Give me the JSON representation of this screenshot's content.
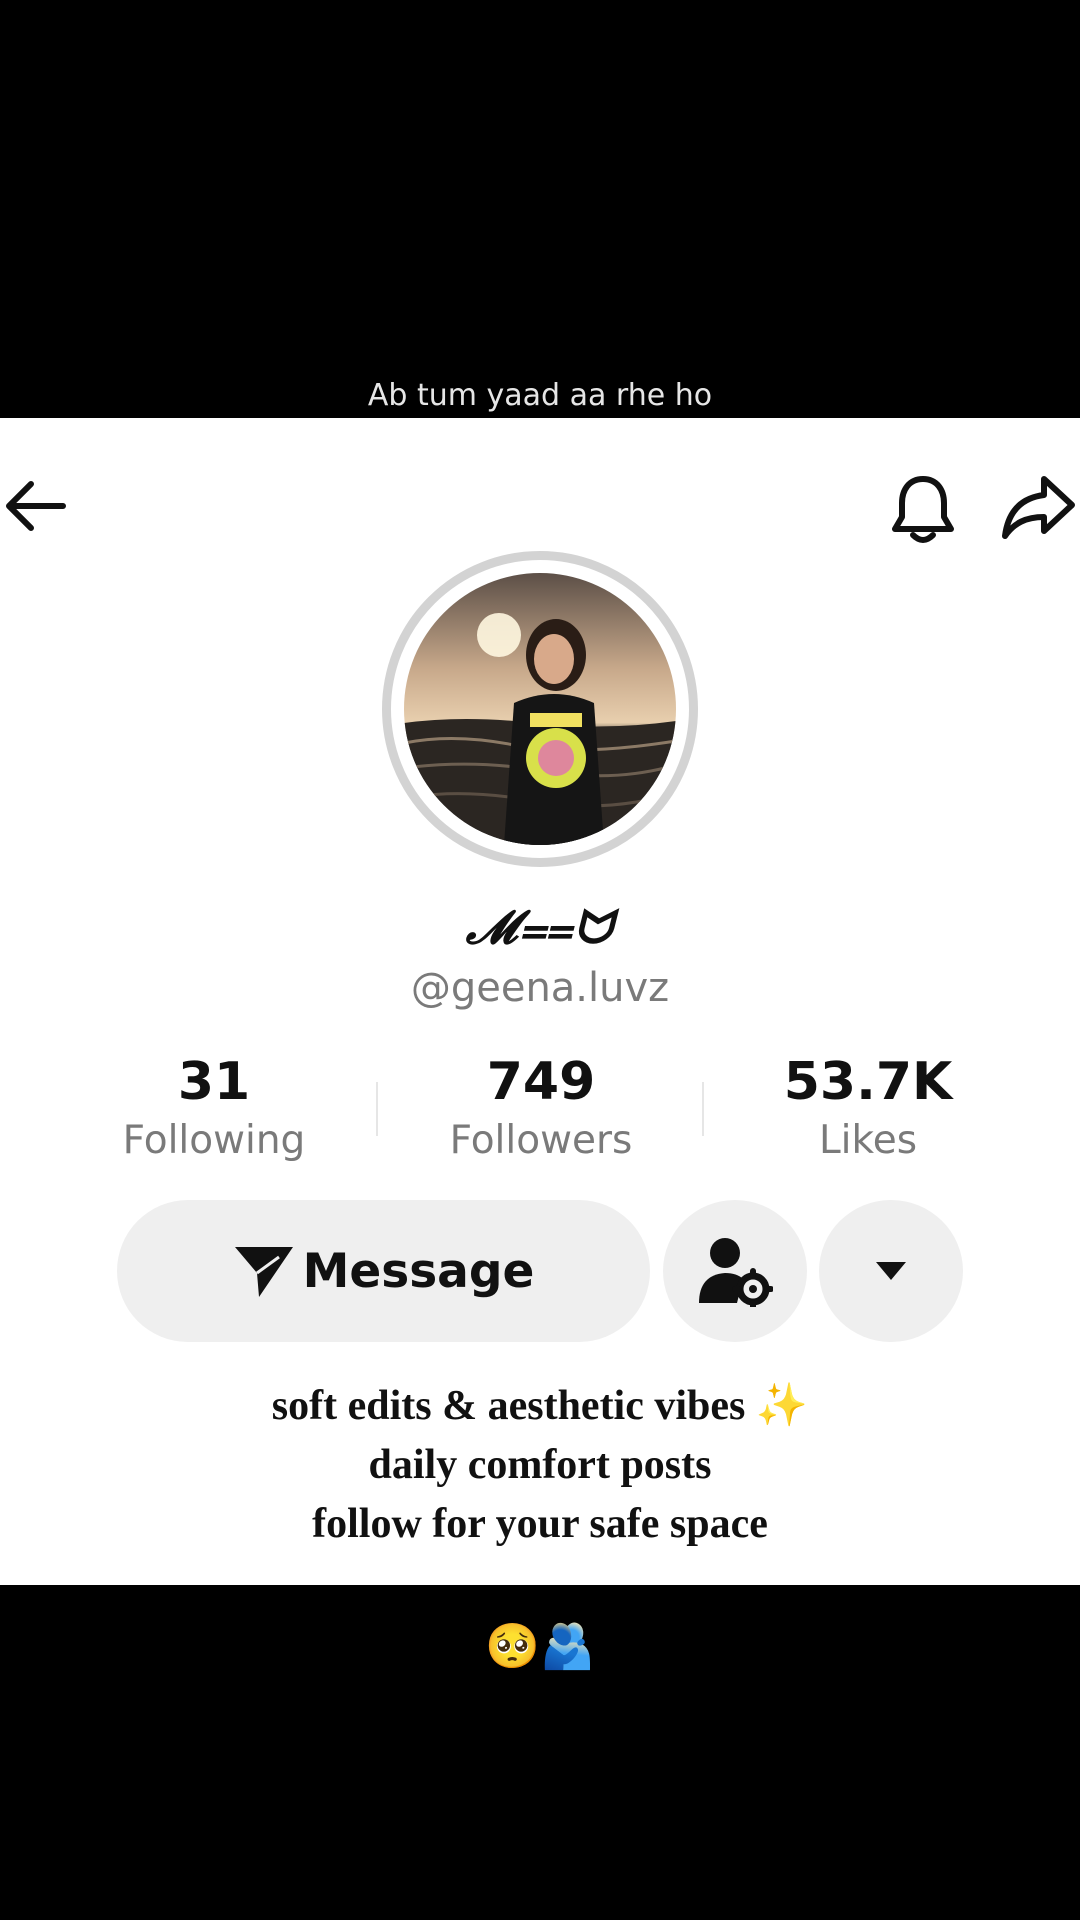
{
  "captions": {
    "top": "Ab tum yaad aa rhe ho",
    "bottom": "🥺🫂"
  },
  "header": {
    "back_icon": "arrow-left-icon",
    "bell_icon": "bell-icon",
    "share_icon": "share-arrow-icon"
  },
  "profile": {
    "display_name": "𝓜⩵ᗢ",
    "username": "@geena.luvz"
  },
  "stats": [
    {
      "value": "31",
      "label": "Following"
    },
    {
      "value": "749",
      "label": "Followers"
    },
    {
      "value": "53.7K",
      "label": "Likes"
    }
  ],
  "actions": {
    "message_label": "Message",
    "add_friend_icon": "user-settings-icon",
    "more_icon": "caret-down-icon"
  },
  "bio": [
    "soft edits & aesthetic vibes ✨",
    "daily comfort posts",
    "follow for your safe space"
  ]
}
